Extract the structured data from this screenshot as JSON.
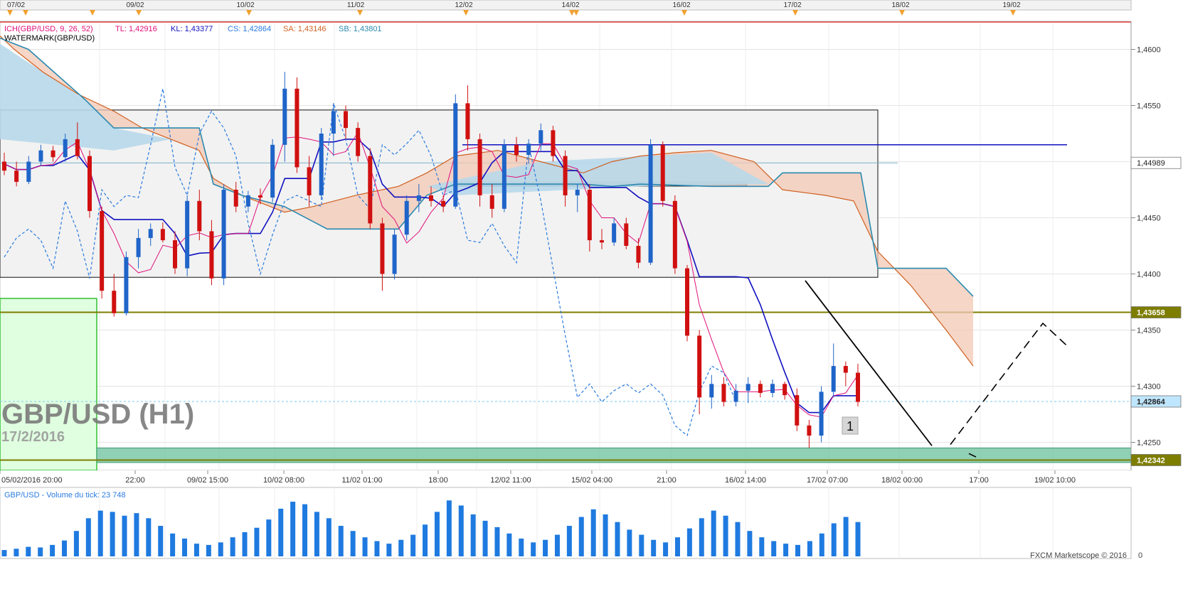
{
  "top_dates": [
    "07/02",
    "09/02",
    "10/02",
    "11/02",
    "12/02",
    "14/02",
    "16/02",
    "17/02",
    "18/02",
    "19/02"
  ],
  "indicator_legend": {
    "ich_name": "ICH(GBP/USD, 9, 26, 52)",
    "tl": "TL: 1,42916",
    "kl": "KL: 1,43377",
    "cs": "CS: 1,42864",
    "sa": "SA: 1,43146",
    "sb": "SB: 1,43801",
    "watermark": "WATERMARK(GBP/USD)"
  },
  "watermark": {
    "symbol": "GBP/USD (H1)",
    "date": "17/2/2016"
  },
  "price_ticks": [
    "1,4600",
    "1,4550",
    "1,4500",
    "1,4450",
    "1,4400",
    "1,4350",
    "1,4300",
    "1,4250"
  ],
  "price_tags": [
    {
      "label": "1,44989",
      "value": 1.44989,
      "bg": "#ffffff",
      "fg": "#222222"
    },
    {
      "label": "1,43658",
      "value": 1.43658,
      "bg": "#7d7d00",
      "fg": "#ffffff"
    },
    {
      "label": "1,42864",
      "value": 1.42864,
      "bg": "#bfe6ff",
      "fg": "#222222"
    },
    {
      "label": "1,42342",
      "value": 1.42342,
      "bg": "#7d7d00",
      "fg": "#ffffff"
    }
  ],
  "time_ticks": [
    "05/02/2016 20:00",
    "22:00",
    "09/02 15:00",
    "10/02 08:00",
    "11/02 01:00",
    "18:00",
    "12/02 11:00",
    "15/02 04:00",
    "21:00",
    "16/02 14:00",
    "17/02 07:00",
    "18/02 00:00",
    "17:00",
    "19/02 10:00"
  ],
  "box_label": "1",
  "volume_label": "GBP/USD - Volume du tick: 23 748",
  "volume_zero": "0",
  "copyright": "FXCM Marketscope © 2016",
  "colors": {
    "up_candle": "#1f64c8",
    "down_candle": "#d01010",
    "tenkan": "#e0107a",
    "kijun": "#1010c0",
    "chikou": "#2a7be0",
    "senkou_a": "#d06020",
    "senkou_b": "#2a8ab0",
    "cloud_bull": "#b8d8ea",
    "cloud_bear": "#f3c8b4",
    "horizontal_line": "#7d7d00",
    "volume": "#1f7ae0"
  },
  "chart_data": {
    "type": "candlestick",
    "symbol": "GBP/USD",
    "timeframe": "H1",
    "ylim": [
      1.4225,
      1.4625
    ],
    "horizontal_levels": [
      1.44989,
      1.43658,
      1.42342,
      1.4515
    ],
    "rectangle_zone": {
      "from": 1.4397,
      "to": 1.4546
    },
    "green_zone": {
      "from": 1.4232,
      "to": 1.4245
    },
    "current_price": 1.42864,
    "candles_approx": [
      {
        "o": 1.45,
        "h": 1.4508,
        "l": 1.4488,
        "c": 1.4492
      },
      {
        "o": 1.4492,
        "h": 1.45,
        "l": 1.4478,
        "c": 1.4482
      },
      {
        "o": 1.4482,
        "h": 1.4505,
        "l": 1.448,
        "c": 1.45
      },
      {
        "o": 1.45,
        "h": 1.4515,
        "l": 1.4496,
        "c": 1.451
      },
      {
        "o": 1.451,
        "h": 1.4514,
        "l": 1.45,
        "c": 1.4504
      },
      {
        "o": 1.4504,
        "h": 1.4525,
        "l": 1.45,
        "c": 1.452
      },
      {
        "o": 1.452,
        "h": 1.4535,
        "l": 1.4502,
        "c": 1.4505
      },
      {
        "o": 1.4505,
        "h": 1.451,
        "l": 1.445,
        "c": 1.4456
      },
      {
        "o": 1.4456,
        "h": 1.446,
        "l": 1.4378,
        "c": 1.4385
      },
      {
        "o": 1.4385,
        "h": 1.44,
        "l": 1.4362,
        "c": 1.4365
      },
      {
        "o": 1.4365,
        "h": 1.442,
        "l": 1.4363,
        "c": 1.4415
      },
      {
        "o": 1.4415,
        "h": 1.444,
        "l": 1.4405,
        "c": 1.4432
      },
      {
        "o": 1.4432,
        "h": 1.4445,
        "l": 1.4425,
        "c": 1.444
      },
      {
        "o": 1.444,
        "h": 1.4446,
        "l": 1.4428,
        "c": 1.443
      },
      {
        "o": 1.443,
        "h": 1.4438,
        "l": 1.44,
        "c": 1.4405
      },
      {
        "o": 1.4405,
        "h": 1.447,
        "l": 1.4398,
        "c": 1.4465
      },
      {
        "o": 1.4465,
        "h": 1.4475,
        "l": 1.443,
        "c": 1.4438
      },
      {
        "o": 1.4438,
        "h": 1.4448,
        "l": 1.439,
        "c": 1.4396
      },
      {
        "o": 1.4396,
        "h": 1.448,
        "l": 1.439,
        "c": 1.4475
      },
      {
        "o": 1.4475,
        "h": 1.4482,
        "l": 1.4455,
        "c": 1.446
      },
      {
        "o": 1.446,
        "h": 1.4474,
        "l": 1.4455,
        "c": 1.447
      },
      {
        "o": 1.447,
        "h": 1.4476,
        "l": 1.4462,
        "c": 1.4468
      },
      {
        "o": 1.4468,
        "h": 1.452,
        "l": 1.4464,
        "c": 1.4515
      },
      {
        "o": 1.4515,
        "h": 1.458,
        "l": 1.45,
        "c": 1.4565
      },
      {
        "o": 1.4565,
        "h": 1.4575,
        "l": 1.449,
        "c": 1.4495
      },
      {
        "o": 1.4495,
        "h": 1.4505,
        "l": 1.446,
        "c": 1.447
      },
      {
        "o": 1.447,
        "h": 1.453,
        "l": 1.4466,
        "c": 1.4525
      },
      {
        "o": 1.4525,
        "h": 1.4552,
        "l": 1.4505,
        "c": 1.4545
      },
      {
        "o": 1.4545,
        "h": 1.455,
        "l": 1.452,
        "c": 1.453
      },
      {
        "o": 1.453,
        "h": 1.4535,
        "l": 1.45,
        "c": 1.4505
      },
      {
        "o": 1.4505,
        "h": 1.4512,
        "l": 1.444,
        "c": 1.4445
      },
      {
        "o": 1.4445,
        "h": 1.445,
        "l": 1.4385,
        "c": 1.44
      },
      {
        "o": 1.44,
        "h": 1.444,
        "l": 1.4395,
        "c": 1.4435
      },
      {
        "o": 1.4435,
        "h": 1.447,
        "l": 1.443,
        "c": 1.4465
      },
      {
        "o": 1.4465,
        "h": 1.448,
        "l": 1.4455,
        "c": 1.447
      },
      {
        "o": 1.447,
        "h": 1.4478,
        "l": 1.446,
        "c": 1.4465
      },
      {
        "o": 1.4465,
        "h": 1.447,
        "l": 1.4455,
        "c": 1.446
      },
      {
        "o": 1.446,
        "h": 1.456,
        "l": 1.4458,
        "c": 1.4552
      },
      {
        "o": 1.4552,
        "h": 1.4568,
        "l": 1.451,
        "c": 1.452
      },
      {
        "o": 1.452,
        "h": 1.4525,
        "l": 1.446,
        "c": 1.447
      },
      {
        "o": 1.447,
        "h": 1.448,
        "l": 1.445,
        "c": 1.4458
      },
      {
        "o": 1.4458,
        "h": 1.452,
        "l": 1.4455,
        "c": 1.4515
      },
      {
        "o": 1.4515,
        "h": 1.4522,
        "l": 1.45,
        "c": 1.4506
      },
      {
        "o": 1.4506,
        "h": 1.452,
        "l": 1.4498,
        "c": 1.4516
      },
      {
        "o": 1.4516,
        "h": 1.4534,
        "l": 1.451,
        "c": 1.4528
      },
      {
        "o": 1.4528,
        "h": 1.4532,
        "l": 1.45,
        "c": 1.4505
      },
      {
        "o": 1.4505,
        "h": 1.451,
        "l": 1.446,
        "c": 1.447
      },
      {
        "o": 1.447,
        "h": 1.448,
        "l": 1.4455,
        "c": 1.4475
      },
      {
        "o": 1.4475,
        "h": 1.448,
        "l": 1.442,
        "c": 1.443
      },
      {
        "o": 1.443,
        "h": 1.444,
        "l": 1.4422,
        "c": 1.4428
      },
      {
        "o": 1.4428,
        "h": 1.445,
        "l": 1.4425,
        "c": 1.4445
      },
      {
        "o": 1.4445,
        "h": 1.445,
        "l": 1.4422,
        "c": 1.4425
      },
      {
        "o": 1.4425,
        "h": 1.4432,
        "l": 1.4405,
        "c": 1.441
      },
      {
        "o": 1.441,
        "h": 1.452,
        "l": 1.4408,
        "c": 1.4515
      },
      {
        "o": 1.4515,
        "h": 1.4518,
        "l": 1.446,
        "c": 1.4465
      },
      {
        "o": 1.4465,
        "h": 1.447,
        "l": 1.44,
        "c": 1.4405
      },
      {
        "o": 1.4405,
        "h": 1.4408,
        "l": 1.434,
        "c": 1.4345
      },
      {
        "o": 1.4345,
        "h": 1.435,
        "l": 1.4275,
        "c": 1.429
      },
      {
        "o": 1.429,
        "h": 1.431,
        "l": 1.428,
        "c": 1.4302
      },
      {
        "o": 1.4302,
        "h": 1.4308,
        "l": 1.4282,
        "c": 1.4286
      },
      {
        "o": 1.4286,
        "h": 1.4302,
        "l": 1.4282,
        "c": 1.4296
      },
      {
        "o": 1.4296,
        "h": 1.4308,
        "l": 1.4285,
        "c": 1.4302
      },
      {
        "o": 1.4302,
        "h": 1.4305,
        "l": 1.429,
        "c": 1.4294
      },
      {
        "o": 1.4294,
        "h": 1.4306,
        "l": 1.429,
        "c": 1.4302
      },
      {
        "o": 1.4302,
        "h": 1.4304,
        "l": 1.4288,
        "c": 1.4292
      },
      {
        "o": 1.4292,
        "h": 1.4298,
        "l": 1.426,
        "c": 1.4265
      },
      {
        "o": 1.4265,
        "h": 1.427,
        "l": 1.4245,
        "c": 1.4256
      },
      {
        "o": 1.4256,
        "h": 1.43,
        "l": 1.425,
        "c": 1.4295
      },
      {
        "o": 1.4295,
        "h": 1.4338,
        "l": 1.429,
        "c": 1.4318
      },
      {
        "o": 1.4318,
        "h": 1.4322,
        "l": 1.43,
        "c": 1.4312
      },
      {
        "o": 1.4312,
        "h": 1.432,
        "l": 1.4282,
        "c": 1.4286
      }
    ],
    "volume_approx": [
      10,
      12,
      15,
      14,
      18,
      25,
      40,
      60,
      72,
      70,
      64,
      68,
      60,
      48,
      36,
      28,
      20,
      18,
      22,
      30,
      38,
      45,
      58,
      75,
      86,
      82,
      70,
      60,
      48,
      40,
      30,
      24,
      20,
      26,
      34,
      50,
      70,
      88,
      80,
      66,
      56,
      46,
      36,
      28,
      22,
      26,
      34,
      48,
      62,
      74,
      66,
      54,
      42,
      34,
      26,
      22,
      30,
      44,
      60,
      72,
      64,
      54,
      40,
      30,
      24,
      20,
      18,
      24,
      36,
      52,
      62,
      54
    ]
  }
}
